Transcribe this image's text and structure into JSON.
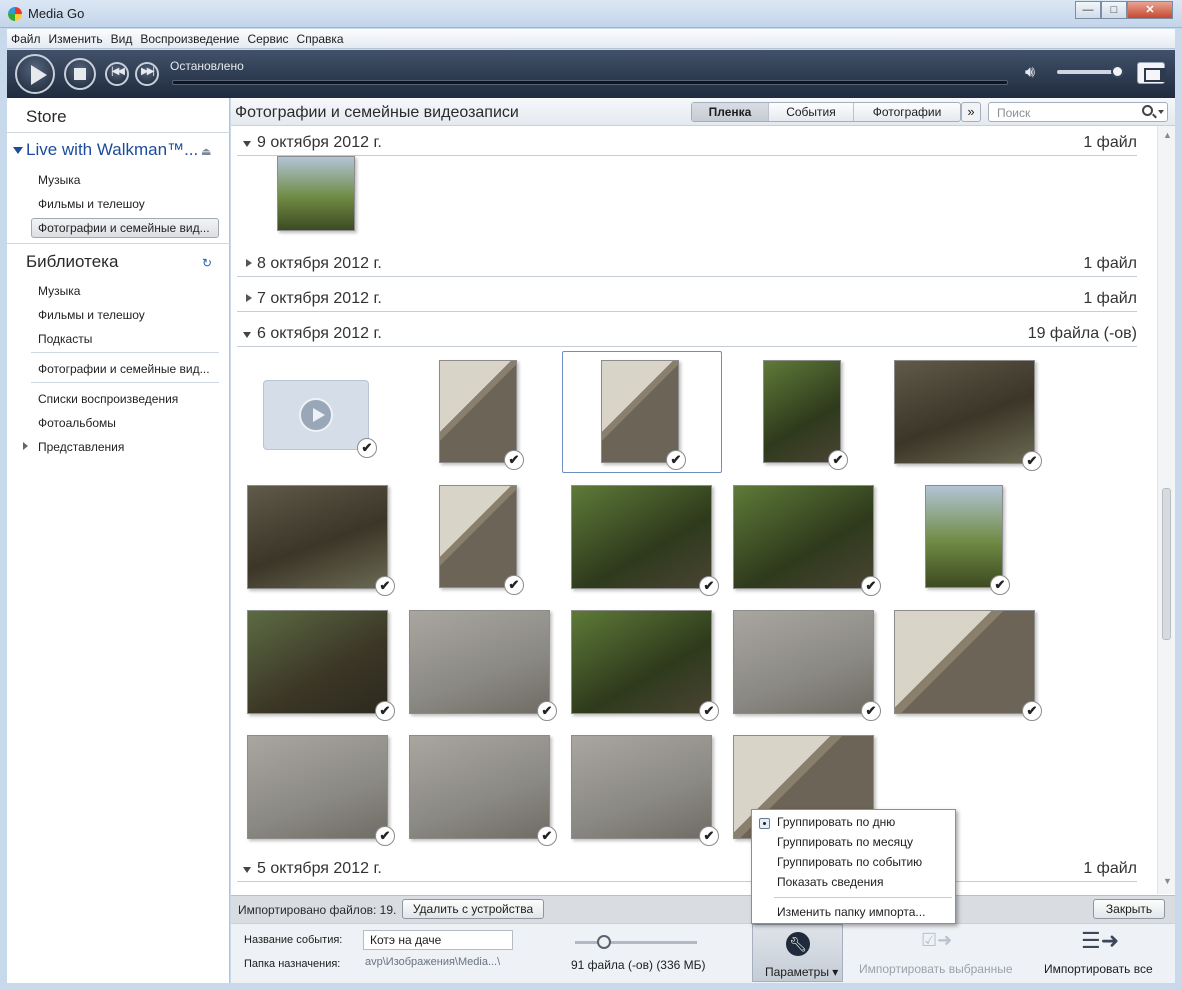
{
  "window": {
    "title": "Media Go",
    "min": "—",
    "max": "□",
    "close": "✕"
  },
  "menu": [
    "Файл",
    "Изменить",
    "Вид",
    "Воспроизведение",
    "Сервис",
    "Справка"
  ],
  "player": {
    "status": "Остановлено",
    "volume_fraction": 0.9
  },
  "sidebar": {
    "store": "Store",
    "device": "Live with Walkman™...",
    "device_eject": "⏏",
    "device_items": [
      "Музыка",
      "Фильмы и телешоу",
      "Фотографии и семейные вид..."
    ],
    "library": "Библиотека",
    "library_items": [
      "Музыка",
      "Фильмы и телешоу",
      "Подкасты",
      "Фотографии и семейные вид...",
      "Списки воспроизведения",
      "Фотоальбомы",
      "Представления"
    ]
  },
  "content": {
    "title": "Фотографии и семейные видеозаписи",
    "tabs": [
      "Пленка",
      "События",
      "Фотографии"
    ],
    "tabs_more": "»",
    "search_placeholder": "Поиск",
    "groups": [
      {
        "date": "9 октября 2012 г.",
        "count": "1 файл"
      },
      {
        "date": "8 октября 2012 г.",
        "count": "1 файл"
      },
      {
        "date": "7 октября 2012 г.",
        "count": "1 файл"
      },
      {
        "date": "6 октября 2012 г.",
        "count": "19 файла (-ов)"
      },
      {
        "date": "5 октября 2012 г.",
        "count": "1 файл"
      }
    ],
    "check": "✔"
  },
  "infobar": {
    "text": "Импортировано файлов: 19.",
    "remove_button": "Удалить с устройства",
    "close_button": "Закрыть"
  },
  "bottom": {
    "event_label": "Название события:",
    "event_value": "Котэ на даче",
    "dest_label": "Папка назначения:",
    "dest_value": "avp\\Изображения\\Media...\\",
    "files_count": "91 файла (-ов) (336 МБ)",
    "params_button": "Параметры ▾",
    "import_selected": "Импортировать выбранные",
    "import_all": "Импортировать все"
  },
  "popup": {
    "items": [
      "Группировать по дню",
      "Группировать по месяцу",
      "Группировать по событию",
      "Показать сведения",
      "Изменить папку импорта..."
    ]
  }
}
